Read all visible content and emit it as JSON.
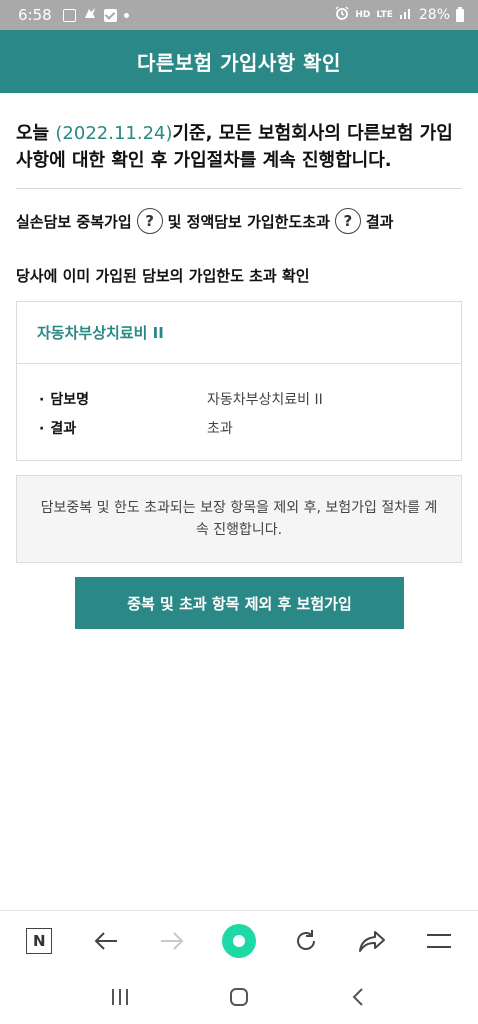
{
  "status_bar": {
    "time": "6:58",
    "network": "LTE",
    "hd_label": "HD",
    "battery": "28%"
  },
  "header": {
    "title": "다른보험 가입사항 확인"
  },
  "intro": {
    "prefix": "오늘 ",
    "date": "(2022.11.24)",
    "suffix": "기준, 모든 보험회사의 다른보험 가입사항에 대한 확인 후 가입절차를 계속 진행합니다."
  },
  "check_line": {
    "part1": "실손담보 중복가입",
    "part2": "및 정액담보 가입한도초과",
    "part3": "결과",
    "help_glyph": "?"
  },
  "limit_check": {
    "title": "당사에 이미 가입된 담보의 가입한도 초과 확인"
  },
  "result_card": {
    "title": "자동차부상치료비 II",
    "rows": [
      {
        "label": "담보명",
        "value": "자동차부상치료비 II"
      },
      {
        "label": "결과",
        "value": "초과"
      }
    ]
  },
  "notice": {
    "text": "담보중복 및 한도 초과되는 보장 항목을 제외 후, 보험가입 절차를 계속 진행합니다."
  },
  "primary_button": {
    "label": "중복 및 초과 항목 제외 후 보험가입"
  },
  "browser_toolbar": {
    "home_label": "N",
    "icons": [
      "naver-home-icon",
      "back-arrow-icon",
      "forward-arrow-icon",
      "green-dot-icon",
      "refresh-icon",
      "share-icon",
      "menu-icon"
    ]
  },
  "nav_bar": {
    "icons": [
      "recent-apps-icon",
      "home-icon",
      "back-icon"
    ]
  },
  "colors": {
    "primary": "#2a8886",
    "status_bar": "#a9a9a9",
    "accent_green": "#1ed9a5",
    "notice_bg": "#f5f5f5"
  }
}
